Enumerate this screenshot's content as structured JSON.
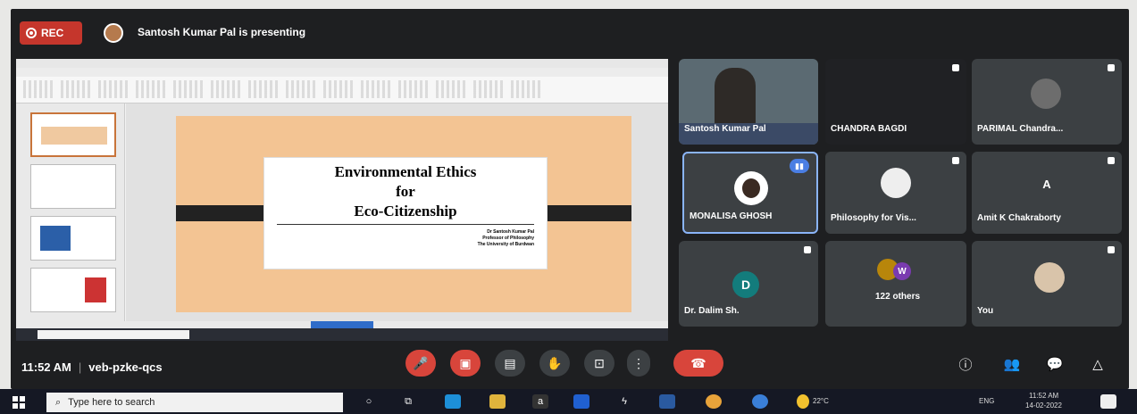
{
  "meet": {
    "rec_label": "REC",
    "presenting_text": "Santosh Kumar Pal is presenting",
    "clock": "11:52 AM",
    "meeting_code": "veb-pzke-qcs"
  },
  "slide": {
    "line1": "Environmental Ethics",
    "line2": "for",
    "line3": "Eco-Citizenship",
    "author": "Dr Santosh Kumar Pal",
    "role": "Professor of Philosophy",
    "university": "The University of Burdwan"
  },
  "participants": [
    {
      "name": "Santosh Kumar Pal"
    },
    {
      "name": "CHANDRA BAGDI"
    },
    {
      "name": "PARIMAL Chandra..."
    },
    {
      "name": "MONALISA GHOSH"
    },
    {
      "name": "Philosophy for Vis..."
    },
    {
      "name": "Amit K Chakraborty",
      "initial": "A"
    },
    {
      "name": "Dr. Dalim Sh.",
      "initial": "D"
    },
    {
      "name": "122 others",
      "initial": "W"
    },
    {
      "name": "You"
    }
  ],
  "taskbar": {
    "search_placeholder": "Type here to search",
    "temperature": "22°C",
    "language": "ENG",
    "time": "11:52 AM",
    "date": "14-02-2022"
  },
  "colors": {
    "meet_bg": "#1e1f21",
    "tile_bg": "#3c4043",
    "red": "#d8453b",
    "slide_bg": "#f3c493",
    "speaking_blue": "#4a7ee3"
  }
}
